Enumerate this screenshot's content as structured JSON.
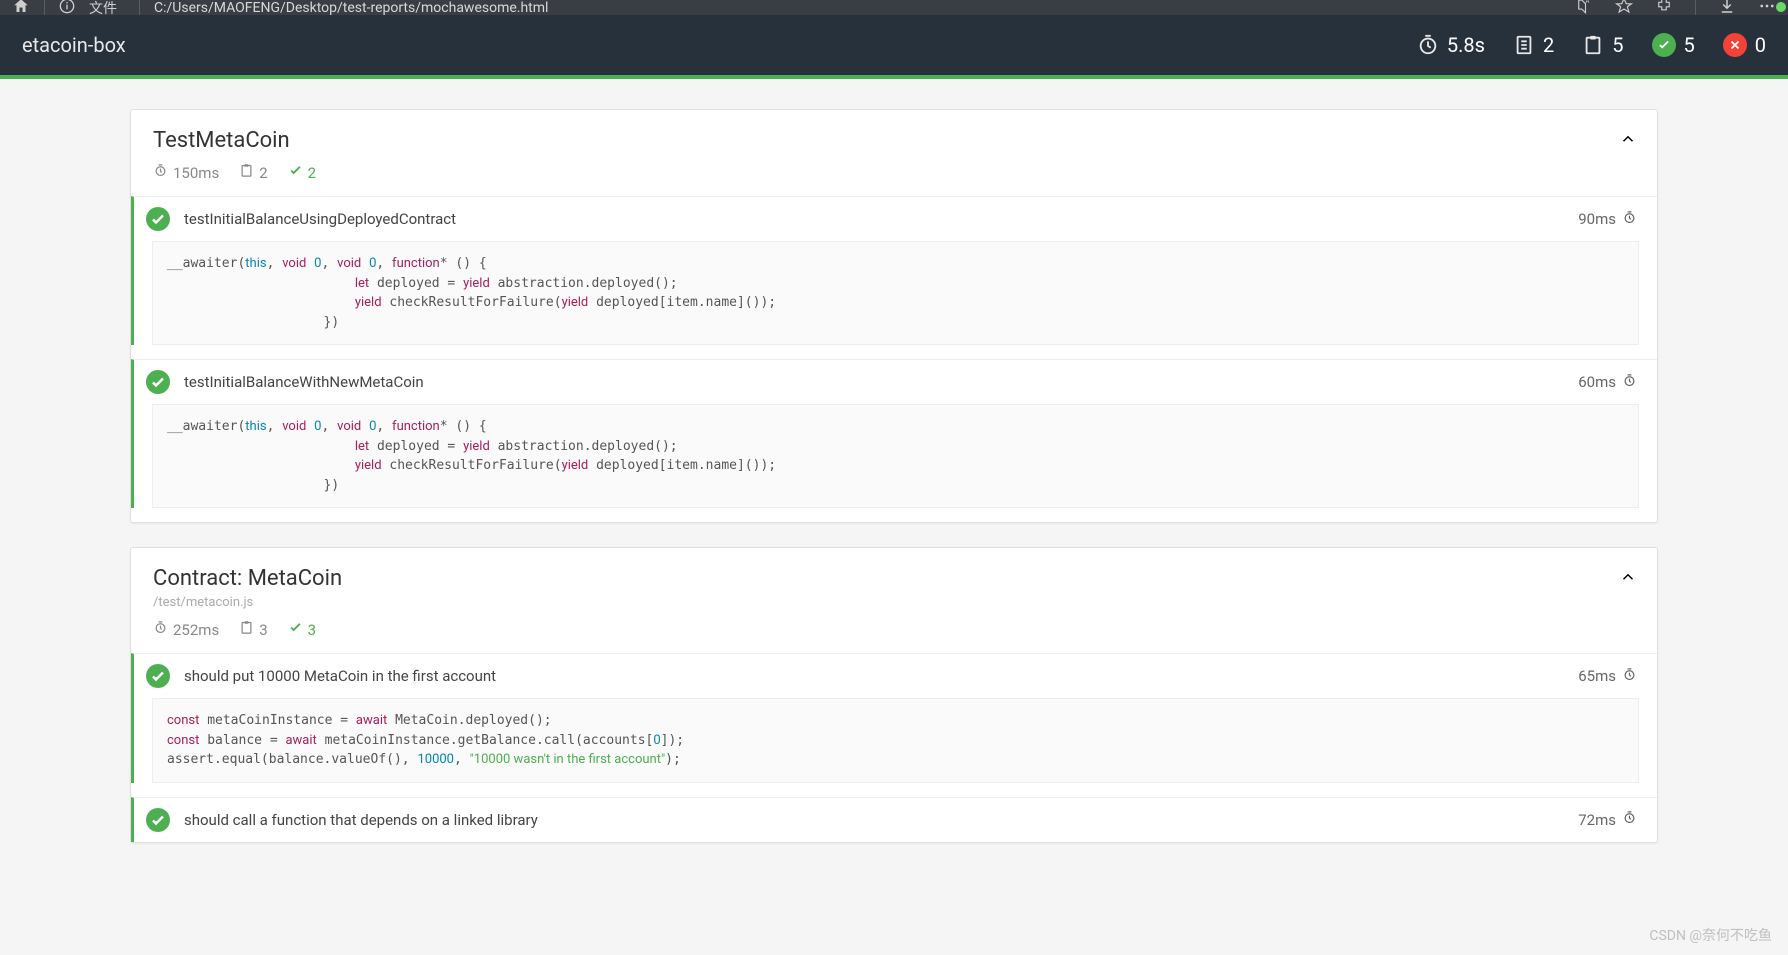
{
  "browser": {
    "file_label": "文件",
    "url": "C:/Users/MAOFENG/Desktop/test-reports/mochawesome.html"
  },
  "header": {
    "title": "etacoin-box",
    "duration": "5.8s",
    "suites": "2",
    "tests": "5",
    "passes": "5",
    "failures": "0"
  },
  "suites": [
    {
      "title": "TestMetaCoin",
      "file": "",
      "duration": "150ms",
      "test_count": "2",
      "pass_count": "2",
      "tests": [
        {
          "name": "testInitialBalanceUsingDeployedContract",
          "time": "90ms",
          "timer_class": "timer-red",
          "code_html": "__awaiter(<span class='kw-this'>this</span>, <span class='kw-void'>void</span> <span class='kw-num'>0</span>, <span class='kw-void'>void</span> <span class='kw-num'>0</span>, <span class='kw-fn'>function</span>* () {\n                        <span class='kw-let'>let</span> deployed = <span class='kw-let'>yield</span> abstraction.deployed();\n                        <span class='kw-let'>yield</span> checkResultForFailure(<span class='kw-let'>yield</span> deployed[item.name]());\n                    })"
        },
        {
          "name": "testInitialBalanceWithNewMetaCoin",
          "time": "60ms",
          "timer_class": "timer-amber",
          "code_html": "__awaiter(<span class='kw-this'>this</span>, <span class='kw-void'>void</span> <span class='kw-num'>0</span>, <span class='kw-void'>void</span> <span class='kw-num'>0</span>, <span class='kw-fn'>function</span>* () {\n                        <span class='kw-let'>let</span> deployed = <span class='kw-let'>yield</span> abstraction.deployed();\n                        <span class='kw-let'>yield</span> checkResultForFailure(<span class='kw-let'>yield</span> deployed[item.name]());\n                    })"
        }
      ]
    },
    {
      "title": "Contract: MetaCoin",
      "file": "/test/metacoin.js",
      "duration": "252ms",
      "test_count": "3",
      "pass_count": "3",
      "tests": [
        {
          "name": "should put 10000 MetaCoin in the first account",
          "time": "65ms",
          "timer_class": "timer-amber",
          "code_html": "<span class='kw-const'>const</span> metaCoinInstance = <span class='kw-await'>await</span> MetaCoin.deployed();\n<span class='kw-const'>const</span> balance = <span class='kw-await'>await</span> metaCoinInstance.getBalance.call(accounts[<span class='kw-num'>0</span>]);\nassert.equal(balance.valueOf(), <span class='kw-num'>10000</span>, <span class='kw-str'>\"10000 wasn't in the first account\"</span>);"
        },
        {
          "name": "should call a function that depends on a linked library",
          "time": "72ms",
          "timer_class": "timer-amber",
          "code_html": ""
        }
      ]
    }
  ],
  "watermark": "CSDN @奈何不吃鱼"
}
